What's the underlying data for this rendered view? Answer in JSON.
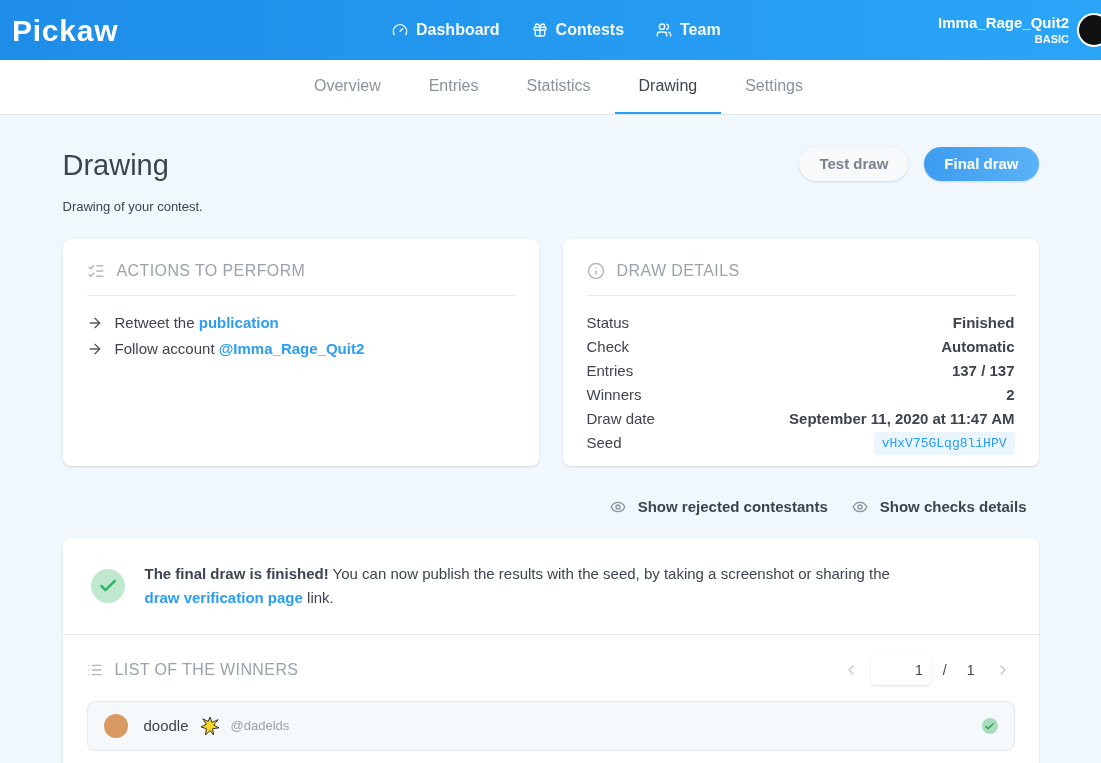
{
  "header": {
    "logo": "Pickaw",
    "nav": [
      {
        "label": "Dashboard"
      },
      {
        "label": "Contests"
      },
      {
        "label": "Team"
      }
    ],
    "user": {
      "name": "Imma_Rage_Quit2",
      "plan": "BASIC"
    }
  },
  "tabs": [
    {
      "label": "Overview",
      "selected": false
    },
    {
      "label": "Entries",
      "selected": false
    },
    {
      "label": "Statistics",
      "selected": false
    },
    {
      "label": "Drawing",
      "selected": true
    },
    {
      "label": "Settings",
      "selected": false
    }
  ],
  "page": {
    "title": "Drawing",
    "subtitle": "Drawing of your contest.",
    "buttons": [
      {
        "label": "Test draw",
        "kind": "secondary"
      },
      {
        "label": "Final draw",
        "kind": "primary"
      }
    ]
  },
  "actions": {
    "title": "ACTIONS TO PERFORM",
    "items": [
      {
        "text": "Retweet the",
        "link": "publication"
      },
      {
        "text": "Follow account",
        "link": "@Imma_Rage_Quit2"
      }
    ]
  },
  "details": {
    "title": "DRAW DETAILS",
    "rows": [
      {
        "label": "Status",
        "value": "Finished",
        "kind": "text"
      },
      {
        "label": "Check",
        "value": "Automatic",
        "kind": "text"
      },
      {
        "label": "Entries",
        "value": "137 / 137",
        "kind": "text"
      },
      {
        "label": "Winners",
        "value": "2",
        "kind": "text"
      },
      {
        "label": "Draw date",
        "value": "September 11, 2020 at 11:47 AM",
        "kind": "text"
      },
      {
        "label": "Seed",
        "value": "vHxV75GLqg8liHPV",
        "kind": "code"
      }
    ]
  },
  "toggles": [
    "Show rejected contestants",
    "Show checks details"
  ],
  "result": {
    "bold": "The final draw is finished!",
    "text": "You can now publish the results with the seed, by taking a screenshot or sharing the",
    "link": "draw verification page",
    "after": "link."
  },
  "winners": {
    "title": "LIST OF THE WINNERS",
    "page": "1",
    "separator": "/",
    "total": "1",
    "rows": [
      {
        "name": "doodle",
        "handle": "@dadelds",
        "verified": true
      }
    ]
  }
}
